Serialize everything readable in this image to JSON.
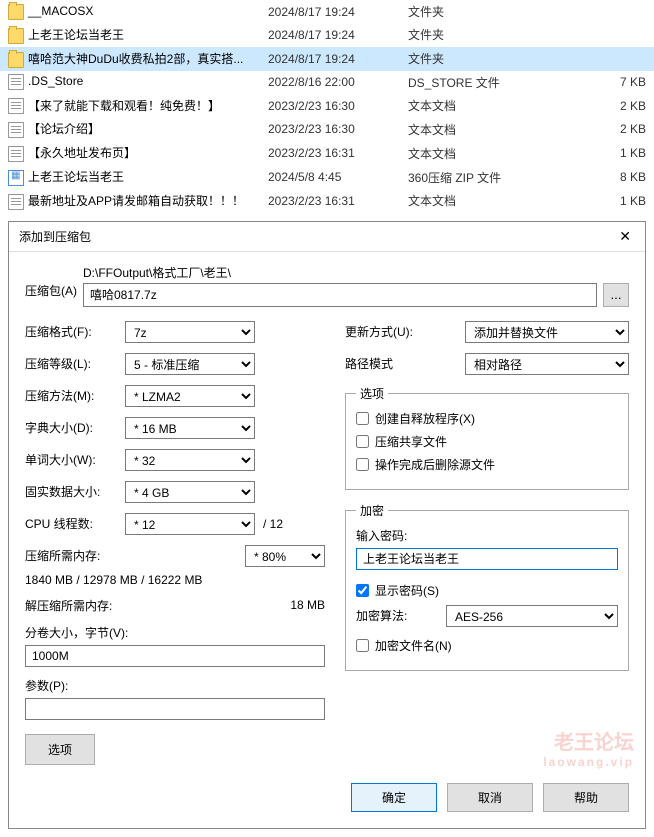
{
  "files": [
    {
      "icon": "folder",
      "name": "__MACOSX",
      "date": "2024/8/17 19:24",
      "type": "文件夹",
      "size": ""
    },
    {
      "icon": "folder",
      "name": "上老王论坛当老王",
      "date": "2024/8/17 19:24",
      "type": "文件夹",
      "size": ""
    },
    {
      "icon": "folder",
      "name": "嘻哈范大神DuDu收费私拍2部，真实搭...",
      "date": "2024/8/17 19:24",
      "type": "文件夹",
      "size": "",
      "selected": true
    },
    {
      "icon": "file",
      "name": ".DS_Store",
      "date": "2022/8/16 22:00",
      "type": "DS_STORE 文件",
      "size": "7 KB"
    },
    {
      "icon": "file",
      "name": "【来了就能下载和观看！纯免费！】",
      "date": "2023/2/23 16:30",
      "type": "文本文档",
      "size": "2 KB"
    },
    {
      "icon": "file",
      "name": "【论坛介绍】",
      "date": "2023/2/23 16:30",
      "type": "文本文档",
      "size": "2 KB"
    },
    {
      "icon": "file",
      "name": "【永久地址发布页】",
      "date": "2023/2/23 16:31",
      "type": "文本文档",
      "size": "1 KB"
    },
    {
      "icon": "zip",
      "name": "上老王论坛当老王",
      "date": "2024/5/8 4:45",
      "type": "360压缩 ZIP 文件",
      "size": "8 KB"
    },
    {
      "icon": "file",
      "name": "最新地址及APP请发邮箱自动获取！！！",
      "date": "2023/2/23 16:31",
      "type": "文本文档",
      "size": "1 KB"
    }
  ],
  "dialog": {
    "title": "添加到压缩包",
    "archive": {
      "label": "压缩包(A)",
      "path": "D:\\FFOutput\\格式工厂\\老王\\",
      "filename": "嘻哈0817.7z",
      "browse": "..."
    },
    "left": {
      "format_label": "压缩格式(F):",
      "format_value": "7z",
      "level_label": "压缩等级(L):",
      "level_value": "5 - 标准压缩",
      "method_label": "压缩方法(M):",
      "method_value": "* LZMA2",
      "dict_label": "字典大小(D):",
      "dict_value": "* 16 MB",
      "word_label": "单词大小(W):",
      "word_value": "* 32",
      "solid_label": "固实数据大小:",
      "solid_value": "* 4 GB",
      "cpu_label": "CPU 线程数:",
      "cpu_value": "* 12",
      "cpu_trail": "/ 12",
      "mem_comp_label": "压缩所需内存:",
      "mem_comp_pct": "* 80%",
      "mem_comp_text": "1840 MB / 12978 MB / 16222 MB",
      "mem_decomp_label": "解压缩所需内存:",
      "mem_decomp_value": "18 MB",
      "split_label": "分卷大小，字节(V):",
      "split_value": "1000M",
      "params_label": "参数(P):",
      "params_value": "",
      "options_btn": "选项"
    },
    "right": {
      "update_label": "更新方式(U):",
      "update_value": "添加并替换文件",
      "pathmode_label": "路径模式",
      "pathmode_value": "相对路径",
      "opts_legend": "选项",
      "opt_sfx": "创建自释放程序(X)",
      "opt_share": "压缩共享文件",
      "opt_delete": "操作完成后删除源文件",
      "enc_legend": "加密",
      "pwd_label": "输入密码:",
      "pwd_value": "上老王论坛当老王",
      "show_pwd": "显示密码(S)",
      "enc_method_label": "加密算法:",
      "enc_method_value": "AES-256",
      "enc_filenames": "加密文件名(N)"
    },
    "buttons": {
      "ok": "确定",
      "cancel": "取消",
      "help": "帮助"
    }
  },
  "watermark": {
    "main": "老王论坛",
    "sub": "laowang.vip"
  }
}
